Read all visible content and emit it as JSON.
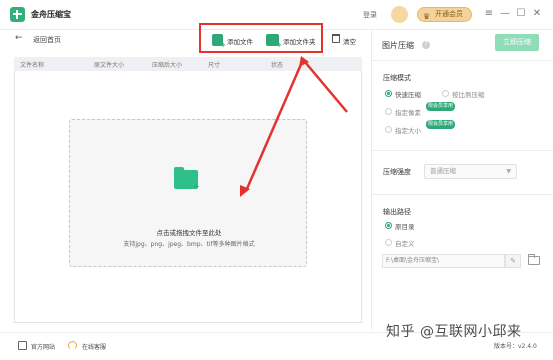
{
  "window": {
    "app_title": "金舟压缩宝",
    "login_label": "登录",
    "vip_label": "开通会员",
    "controls": [
      "≡",
      "—",
      "☐",
      "✕"
    ]
  },
  "toolbar": {
    "back_label": "返回首页",
    "add_file_label": "添加文件",
    "add_folder_label": "添加文件夹",
    "clear_label": "清空"
  },
  "table": {
    "columns": [
      "文件名称",
      "原文件大小",
      "压缩后大小",
      "尺寸",
      "状态"
    ]
  },
  "drop_zone": {
    "title": "点击或拖拽文件至此处",
    "subtitle": "支持jpg、png、jpeg、bmp、tif等多种图片格式"
  },
  "panel": {
    "title": "图片压缩",
    "compress_button": "立即压缩",
    "mode_section": {
      "label": "压缩模式",
      "options": [
        {
          "label": "快速压缩",
          "selected": true,
          "badge": ""
        },
        {
          "label": "按比例压缩",
          "selected": false,
          "badge": ""
        },
        {
          "label": "指定像素",
          "selected": false,
          "badge": "限会员享用"
        },
        {
          "label": "指定大小",
          "selected": false,
          "badge": "限会员享用"
        }
      ]
    },
    "level_section": {
      "label": "压缩强度",
      "value": "普通压缩"
    },
    "output_section": {
      "label": "输出路径",
      "options": [
        {
          "label": "原目录",
          "selected": true
        },
        {
          "label": "自定义",
          "selected": false
        }
      ],
      "path": "F:\\桌面\\金舟压缩宝\\"
    }
  },
  "footer": {
    "website_label": "官方网站",
    "service_label": "在线客服",
    "version": "版本号：v2.4.0",
    "watermark": "知乎 @互联网小邱来"
  },
  "colors": {
    "accent": "#2fa878",
    "highlight": "#e3332d",
    "vip": "#f3d39b"
  }
}
